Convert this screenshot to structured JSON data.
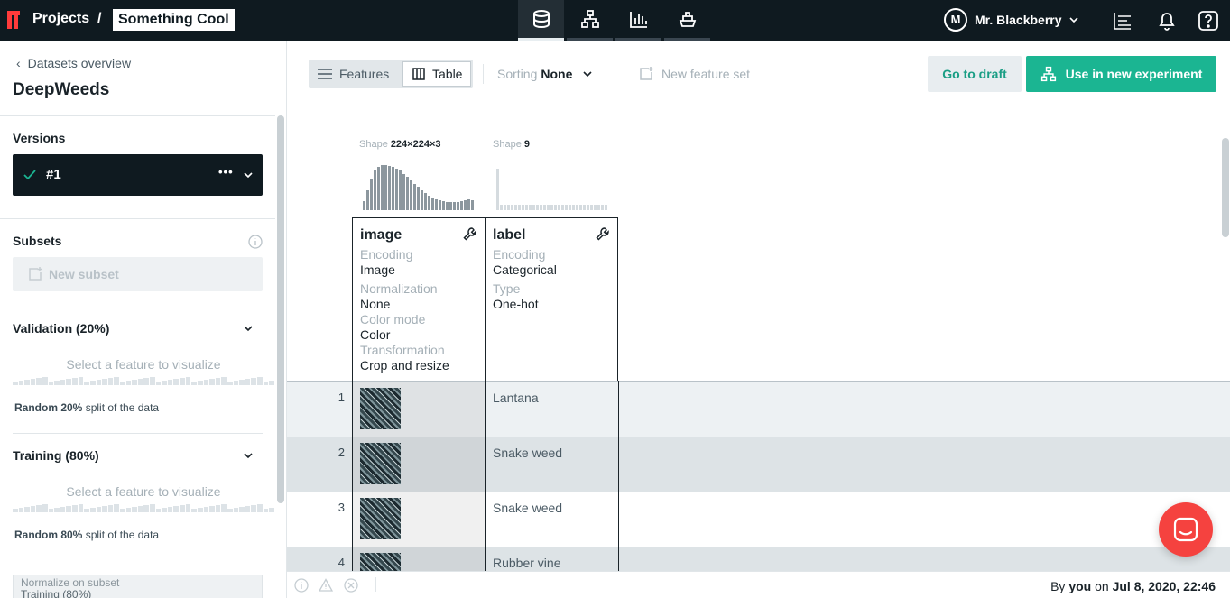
{
  "topbar": {
    "projects_label": "Projects",
    "separator": "/",
    "project_name": "Something Cool",
    "nav_tabs": [
      {
        "icon": "database-icon",
        "active": true
      },
      {
        "icon": "model-tree-icon",
        "active": false
      },
      {
        "icon": "bar-chart-icon",
        "active": false
      },
      {
        "icon": "deploy-ship-icon",
        "active": false
      }
    ],
    "user_initial": "M",
    "user_name": "Mr. Blackberry",
    "icons": [
      "queue-icon",
      "bell-icon",
      "help-icon"
    ]
  },
  "sidebar": {
    "back_link": "Datasets overview",
    "dataset_title": "DeepWeeds",
    "versions_label": "Versions",
    "version_value": "#1",
    "version_menu": "•••",
    "subsets_label": "Subsets",
    "new_subset": "New subset",
    "validation": {
      "title": "Validation (20%)",
      "placeholder": "Select a feature to visualize",
      "note_bold": "Random 20%",
      "note_rest": "split of the data"
    },
    "training": {
      "title": "Training (80%)",
      "placeholder": "Select a feature to visualize",
      "note_bold": "Random 80%",
      "note_rest": "split of the data"
    },
    "normalize_label": "Normalize on subset",
    "normalize_value": "Training (80%)"
  },
  "toolbar": {
    "features_label": "Features",
    "table_label": "Table",
    "sorting_label": "Sorting",
    "sorting_value": "None",
    "new_feature_set": "New feature set",
    "go_to_draft": "Go to draft",
    "use_in_experiment": "Use in new experiment"
  },
  "columns": [
    {
      "name": "image",
      "shape_label": "Shape",
      "shape_value": "224×224×3",
      "fields": [
        {
          "key": "Encoding",
          "value": "Image"
        },
        {
          "key": "Normalization",
          "value": "None"
        },
        {
          "key": "Color mode",
          "value": "Color"
        },
        {
          "key": "Transformation",
          "value": "Crop and resize"
        }
      ]
    },
    {
      "name": "label",
      "shape_label": "Shape",
      "shape_value": "9",
      "fields": [
        {
          "key": "Encoding",
          "value": "Categorical"
        },
        {
          "key": "Type",
          "value": "One-hot"
        }
      ]
    }
  ],
  "rows": [
    {
      "index": "1",
      "label": "Lantana"
    },
    {
      "index": "2",
      "label": "Snake weed"
    },
    {
      "index": "3",
      "label": "Snake weed"
    },
    {
      "index": "4",
      "label": "Rubber vine"
    }
  ],
  "status": {
    "by": "By",
    "user": "you",
    "on": "on",
    "timestamp": "Jul 8, 2020, 22:46"
  },
  "colors": {
    "topbar": "#0f1a20",
    "brand_red": "#ff3b3b",
    "accent_green": "#1bb592",
    "chat": "#f5423f"
  }
}
